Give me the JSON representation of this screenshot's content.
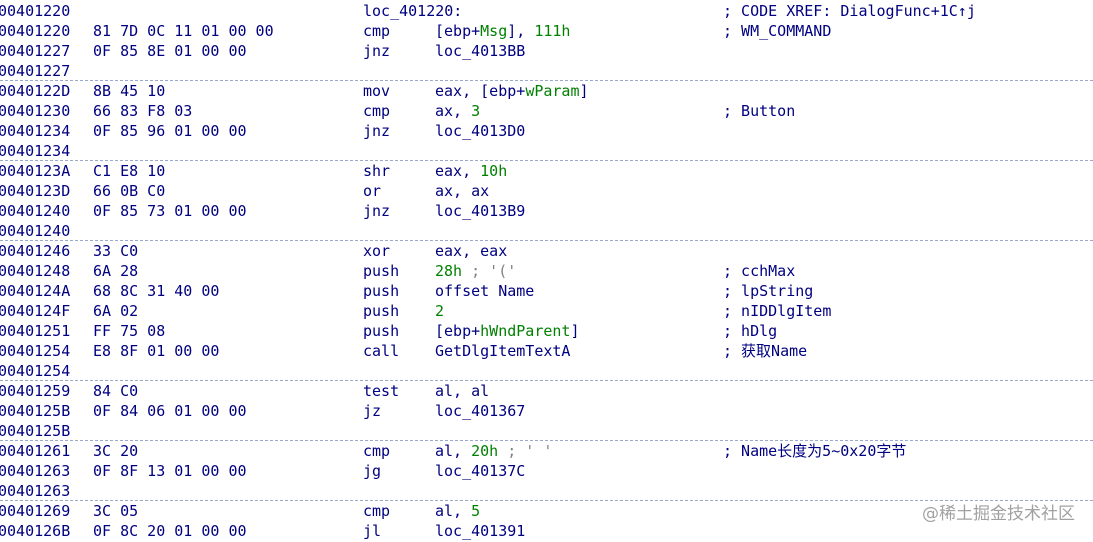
{
  "lines": [
    {
      "addr": "00401220",
      "bytes": "",
      "label": "loc_401220:",
      "mnem": "",
      "ops": [],
      "cmt": "; CODE XREF: DialogFunc+1C↑j"
    },
    {
      "addr": "00401220",
      "bytes": "81 7D 0C 11 01 00 00",
      "mnem": "cmp",
      "ops": [
        {
          "t": "[ebp+",
          "k": ""
        },
        {
          "t": "Msg",
          "k": "sym"
        },
        {
          "t": "], ",
          "k": ""
        },
        {
          "t": "111h",
          "k": "num"
        }
      ],
      "cmt": "; WM_COMMAND"
    },
    {
      "addr": "00401227",
      "bytes": "0F 85 8E 01 00 00",
      "mnem": "jnz",
      "ops": [
        {
          "t": "loc_4013BB",
          "k": ""
        }
      ],
      "cmt": ""
    },
    {
      "addr": "00401227",
      "bytes": "",
      "mnem": "",
      "ops": [],
      "cmt": "",
      "sep": true
    },
    {
      "addr": "0040122D",
      "bytes": "8B 45 10",
      "mnem": "mov",
      "ops": [
        {
          "t": "eax, [ebp+",
          "k": ""
        },
        {
          "t": "wParam",
          "k": "sym"
        },
        {
          "t": "]",
          "k": ""
        }
      ],
      "cmt": ""
    },
    {
      "addr": "00401230",
      "bytes": "66 83 F8 03",
      "mnem": "cmp",
      "ops": [
        {
          "t": "ax, ",
          "k": ""
        },
        {
          "t": "3",
          "k": "num"
        }
      ],
      "cmt": "; Button"
    },
    {
      "addr": "00401234",
      "bytes": "0F 85 96 01 00 00",
      "mnem": "jnz",
      "ops": [
        {
          "t": "loc_4013D0",
          "k": ""
        }
      ],
      "cmt": ""
    },
    {
      "addr": "00401234",
      "bytes": "",
      "mnem": "",
      "ops": [],
      "cmt": "",
      "sep": true
    },
    {
      "addr": "0040123A",
      "bytes": "C1 E8 10",
      "mnem": "shr",
      "ops": [
        {
          "t": "eax, ",
          "k": ""
        },
        {
          "t": "10h",
          "k": "num"
        }
      ],
      "cmt": ""
    },
    {
      "addr": "0040123D",
      "bytes": "66 0B C0",
      "mnem": "or",
      "ops": [
        {
          "t": "ax, ax",
          "k": ""
        }
      ],
      "cmt": ""
    },
    {
      "addr": "00401240",
      "bytes": "0F 85 73 01 00 00",
      "mnem": "jnz",
      "ops": [
        {
          "t": "loc_4013B9",
          "k": ""
        }
      ],
      "cmt": ""
    },
    {
      "addr": "00401240",
      "bytes": "",
      "mnem": "",
      "ops": [],
      "cmt": "",
      "sep": true
    },
    {
      "addr": "00401246",
      "bytes": "33 C0",
      "mnem": "xor",
      "ops": [
        {
          "t": "eax, eax",
          "k": ""
        }
      ],
      "cmt": ""
    },
    {
      "addr": "00401248",
      "bytes": "6A 28",
      "mnem": "push",
      "ops": [
        {
          "t": "28h",
          "k": "num"
        },
        {
          "t": " ; '('",
          "k": "str"
        }
      ],
      "cmt": "; cchMax"
    },
    {
      "addr": "0040124A",
      "bytes": "68 8C 31 40 00",
      "mnem": "push",
      "ops": [
        {
          "t": "offset Name",
          "k": ""
        }
      ],
      "cmt": "; lpString"
    },
    {
      "addr": "0040124F",
      "bytes": "6A 02",
      "mnem": "push",
      "ops": [
        {
          "t": "2",
          "k": "num"
        }
      ],
      "cmt": "; nIDDlgItem"
    },
    {
      "addr": "00401251",
      "bytes": "FF 75 08",
      "mnem": "push",
      "ops": [
        {
          "t": "[ebp+",
          "k": ""
        },
        {
          "t": "hWndParent",
          "k": "sym"
        },
        {
          "t": "]",
          "k": ""
        }
      ],
      "cmt": "; hDlg"
    },
    {
      "addr": "00401254",
      "bytes": "E8 8F 01 00 00",
      "mnem": "call",
      "ops": [
        {
          "t": "GetDlgItemTextA",
          "k": ""
        }
      ],
      "cmt": "; 获取Name"
    },
    {
      "addr": "00401254",
      "bytes": "",
      "mnem": "",
      "ops": [],
      "cmt": "",
      "sep": true
    },
    {
      "addr": "00401259",
      "bytes": "84 C0",
      "mnem": "test",
      "ops": [
        {
          "t": "al, al",
          "k": ""
        }
      ],
      "cmt": ""
    },
    {
      "addr": "0040125B",
      "bytes": "0F 84 06 01 00 00",
      "mnem": "jz",
      "ops": [
        {
          "t": "loc_401367",
          "k": ""
        }
      ],
      "cmt": ""
    },
    {
      "addr": "0040125B",
      "bytes": "",
      "mnem": "",
      "ops": [],
      "cmt": "",
      "sep": true
    },
    {
      "addr": "00401261",
      "bytes": "3C 20",
      "mnem": "cmp",
      "ops": [
        {
          "t": "al, ",
          "k": ""
        },
        {
          "t": "20h",
          "k": "num"
        },
        {
          "t": " ; ' '",
          "k": "str"
        }
      ],
      "cmt": "; Name长度为5~0x20字节"
    },
    {
      "addr": "00401263",
      "bytes": "0F 8F 13 01 00 00",
      "mnem": "jg",
      "ops": [
        {
          "t": "loc_40137C",
          "k": ""
        }
      ],
      "cmt": ""
    },
    {
      "addr": "00401263",
      "bytes": "",
      "mnem": "",
      "ops": [],
      "cmt": "",
      "sep": true
    },
    {
      "addr": "00401269",
      "bytes": "3C 05",
      "mnem": "cmp",
      "ops": [
        {
          "t": "al, ",
          "k": ""
        },
        {
          "t": "5",
          "k": "num"
        }
      ],
      "cmt": ""
    },
    {
      "addr": "0040126B",
      "bytes": "0F 8C 20 01 00 00",
      "mnem": "jl",
      "ops": [
        {
          "t": "loc_401391",
          "k": ""
        }
      ],
      "cmt": ""
    }
  ],
  "watermark": "@稀土掘金技术社区",
  "colors": {
    "text": "#000080",
    "symbol": "#008000",
    "comment": "#000080",
    "divider": "#9aa9c8"
  }
}
